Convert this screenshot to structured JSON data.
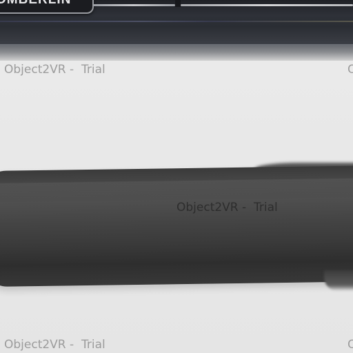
{
  "brand": {
    "text": "OMBERLIN"
  },
  "watermarks": {
    "w1": "Object2VR -  Trial",
    "w2": "O",
    "w3": "Object2VR -  Trial",
    "w4": "Object2VR -  Trial",
    "w5": "O"
  },
  "colors": {
    "background": "#e6e6e6",
    "object_dark": "#3a3a3a",
    "top_band": "#2b2d33",
    "watermark_light": "#9c9c9c",
    "watermark_dark": "#262626"
  }
}
